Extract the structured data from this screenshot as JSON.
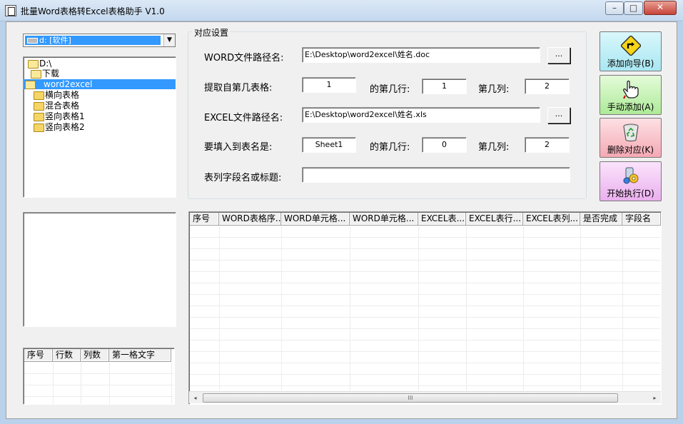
{
  "window": {
    "title": "批量Word表格转Excel表格助手 V1.0",
    "minimize": "–",
    "maximize": "□",
    "close": "✕"
  },
  "drive": {
    "selected": "d: [软件]"
  },
  "folders": [
    {
      "label": "D:\\",
      "state": "open"
    },
    {
      "label": "下载",
      "state": "open"
    },
    {
      "label": "word2excel",
      "state": "selected"
    },
    {
      "label": "横向表格",
      "state": "closed"
    },
    {
      "label": "混合表格",
      "state": "closed"
    },
    {
      "label": "竖向表格1",
      "state": "closed"
    },
    {
      "label": "竖向表格2",
      "state": "closed"
    }
  ],
  "settings": {
    "group_title": "对应设置",
    "word_path_label": "WORD文件路径名:",
    "word_path_value": "E:\\Desktop\\word2excel\\姓名.doc",
    "browse": "...",
    "table_from_label": "提取自第几表格:",
    "table_from_value": "1",
    "row_label": "的第几行:",
    "word_row_value": "1",
    "col_label": "第几列:",
    "word_col_value": "2",
    "excel_path_label": "EXCEL文件路径名:",
    "excel_path_value": "E:\\Desktop\\word2excel\\姓名.xls",
    "sheet_label": "要填入到表名是:",
    "sheet_value": "Sheet1",
    "excel_row_value": "0",
    "excel_col_value": "2",
    "field_label": "表列字段名或标题:",
    "field_value": ""
  },
  "tools": {
    "wizard": "添加向导(B)",
    "manual": "手动添加(A)",
    "delete": "删除对应(K)",
    "execute": "开始执行(D)"
  },
  "small_grid": {
    "headers": [
      "序号",
      "行数",
      "列数",
      "第一格文字"
    ]
  },
  "main_grid": {
    "headers": [
      "序号",
      "WORD表格序...",
      "WORD单元格...",
      "WORD单元格...",
      "EXCEL表...",
      "EXCEL表行...",
      "EXCEL表列...",
      "是否完成",
      "字段名"
    ]
  },
  "scroll": {
    "left": "◂",
    "right": "▸",
    "thumb": "III"
  },
  "colors": {
    "accent": "#3399ff",
    "window_bg": "#f0f0f0",
    "frame": "#b9d1ea"
  }
}
